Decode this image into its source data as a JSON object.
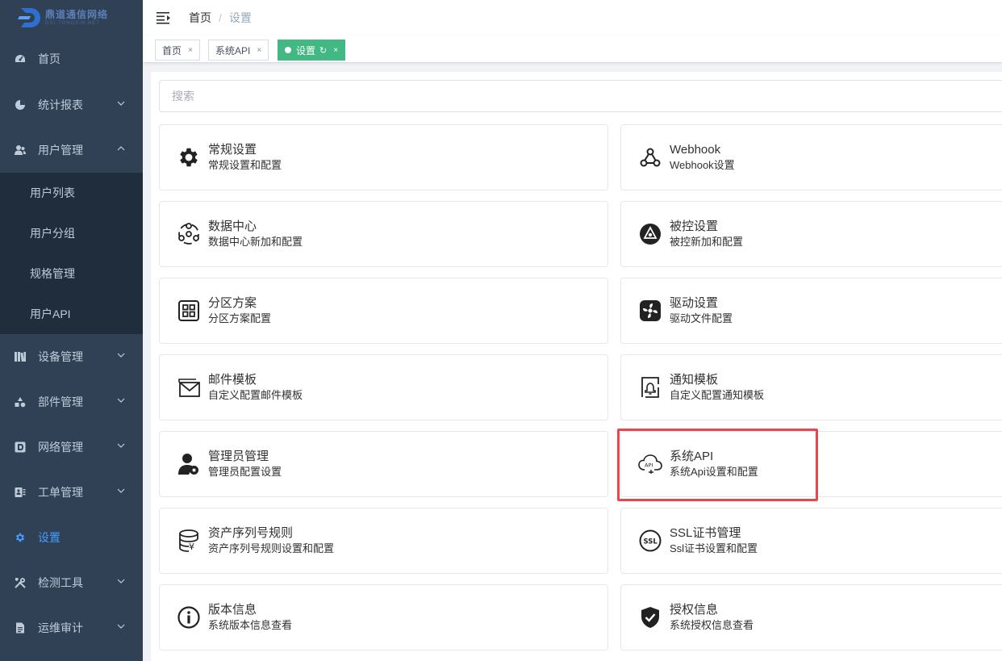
{
  "logo": {
    "title": "鼎道通信网络",
    "subtitle": "DSI-TONGXIN.NET"
  },
  "sidebar": {
    "menu": [
      {
        "label": "首页",
        "icon": "dashboard-icon"
      },
      {
        "label": "统计报表",
        "icon": "pie-chart-icon"
      },
      {
        "label": "用户管理",
        "icon": "users-icon"
      },
      {
        "label": "设备管理",
        "icon": "books-icon"
      },
      {
        "label": "部件管理",
        "icon": "component-icon"
      },
      {
        "label": "网络管理",
        "icon": "network-icon"
      },
      {
        "label": "工单管理",
        "icon": "work-order-icon"
      },
      {
        "label": "设置",
        "icon": "gear-icon"
      },
      {
        "label": "检测工具",
        "icon": "tools-icon"
      },
      {
        "label": "运维审计",
        "icon": "audit-icon"
      }
    ],
    "submenu": [
      "用户列表",
      "用户分组",
      "规格管理",
      "用户API"
    ],
    "active_color": "#409eff"
  },
  "header": {
    "breadcrumb_home": "首页",
    "breadcrumb_sep": "/",
    "breadcrumb_current": "设置"
  },
  "tags": [
    {
      "label": "首页",
      "close": "×"
    },
    {
      "label": "系统API",
      "close": "×"
    },
    {
      "label": "设置",
      "refresh": "↻",
      "close": "×",
      "active": true
    }
  ],
  "search": {
    "placeholder": "搜索"
  },
  "cards": [
    {
      "title": "常规设置",
      "desc": "常规设置和配置",
      "icon": "gear-icon"
    },
    {
      "title": "Webhook",
      "desc": "Webhook设置",
      "icon": "webhook-icon"
    },
    {
      "title": "数据中心",
      "desc": "数据中心新加和配置",
      "icon": "datacenter-icon"
    },
    {
      "title": "被控设置",
      "desc": "被控新加和配置",
      "icon": "controlled-icon"
    },
    {
      "title": "分区方案",
      "desc": "分区方案配置",
      "icon": "partition-icon"
    },
    {
      "title": "驱动设置",
      "desc": "驱动文件配置",
      "icon": "driver-icon"
    },
    {
      "title": "邮件模板",
      "desc": "自定义配置邮件模板",
      "icon": "mail-icon"
    },
    {
      "title": "通知模板",
      "desc": "自定义配置通知模板",
      "icon": "notification-icon"
    },
    {
      "title": "管理员管理",
      "desc": "管理员配置设置",
      "icon": "admin-icon"
    },
    {
      "title": "系统API",
      "desc": "系统Api设置和配置",
      "icon": "cloud-api-icon"
    },
    {
      "title": "资产序列号规则",
      "desc": "资产序列号规则设置和配置",
      "icon": "asset-icon"
    },
    {
      "title": "SSL证书管理",
      "desc": "Ssl证书设置和配置",
      "icon": "ssl-icon"
    },
    {
      "title": "版本信息",
      "desc": "系统版本信息查看",
      "icon": "info-icon"
    },
    {
      "title": "授权信息",
      "desc": "系统授权信息查看",
      "icon": "shield-icon"
    }
  ],
  "colors": {
    "sidebar_bg": "#304156",
    "submenu_bg": "#1f2d3d",
    "tag_active": "#42b983",
    "highlight": "#e8484d"
  }
}
